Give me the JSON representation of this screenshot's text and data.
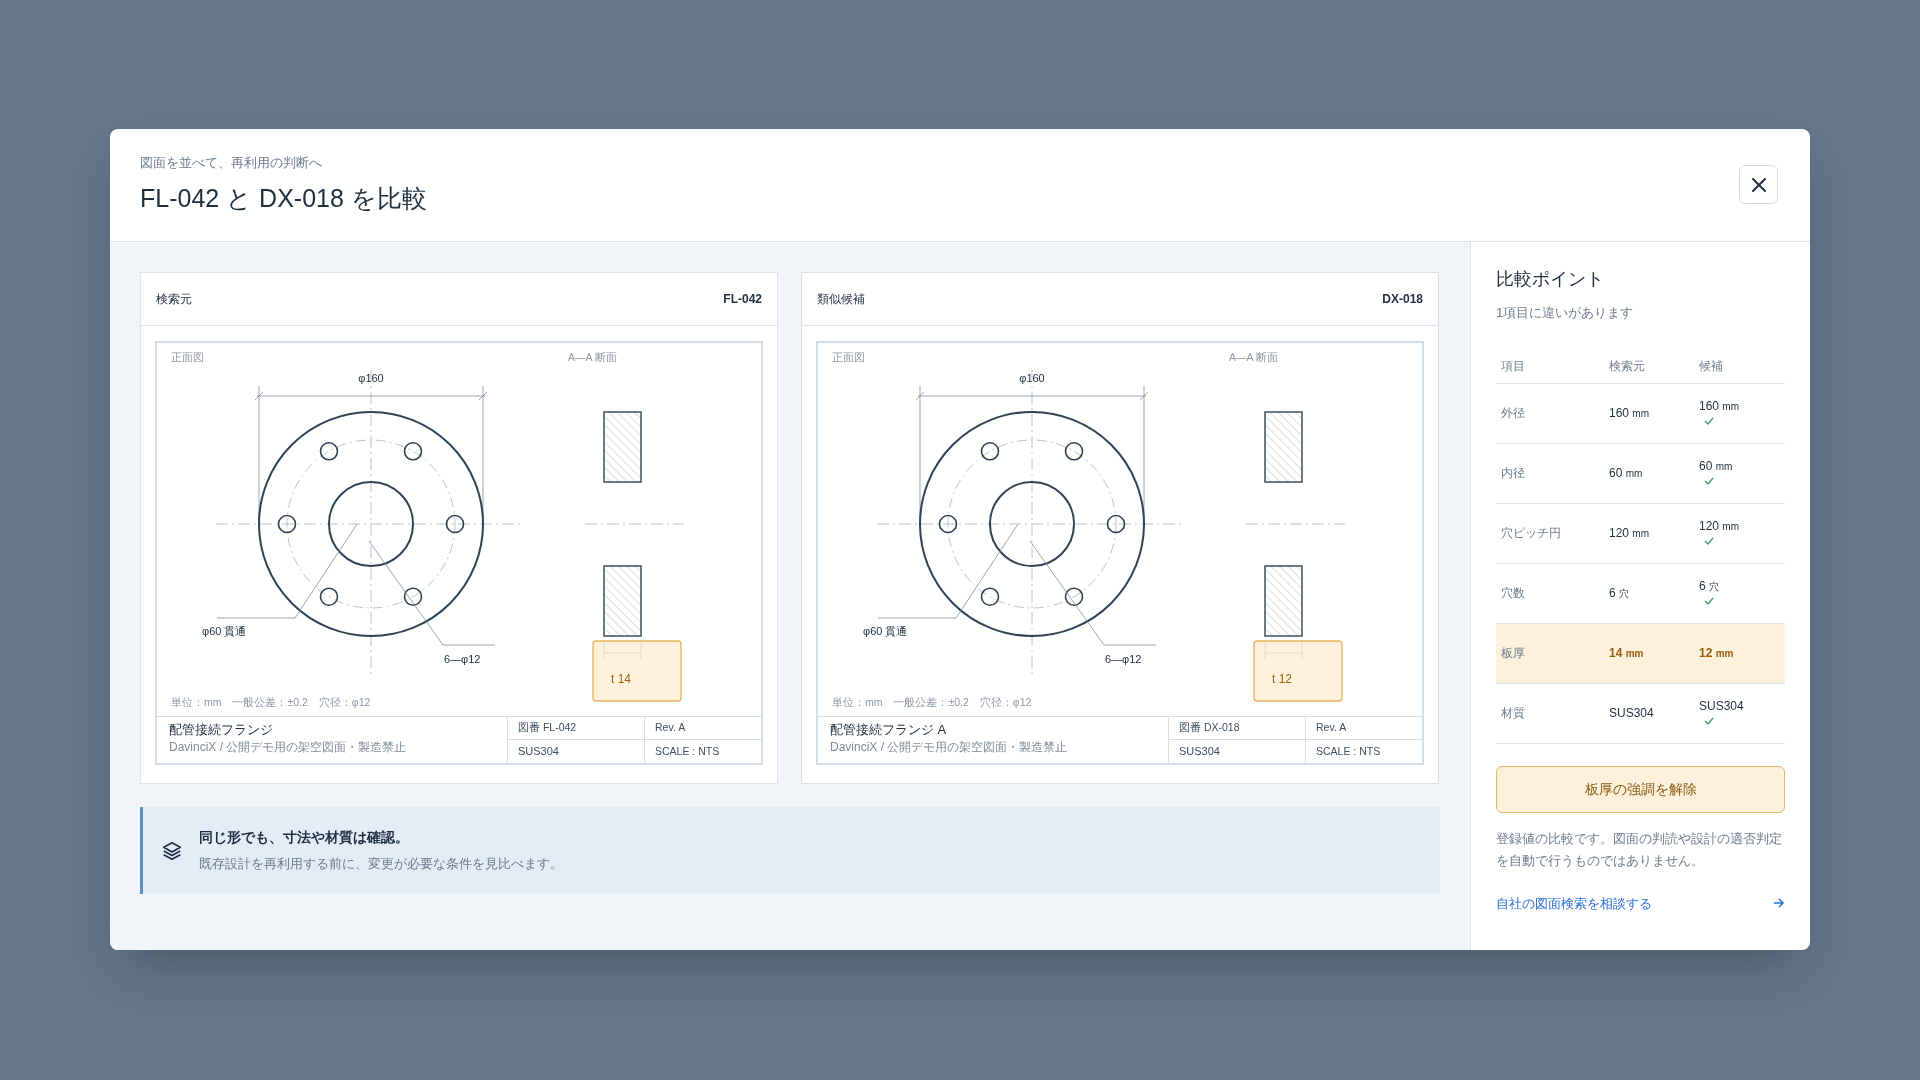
{
  "dialog": {
    "eyebrow": "図面を並べて、再利用の判断へ",
    "title": "FL-042 と DX-018 を比較"
  },
  "drawings": [
    {
      "role": "検索元",
      "code": "FL-042",
      "front_label": "正面図",
      "section_label": "A—A 断面",
      "outer_dim": "φ160",
      "bore_note": "φ60 貫通",
      "holes_note": "6—φ12",
      "thickness": "t 14",
      "thickness_highlighted": true,
      "notes": "単位：mm　一般公差：±0.2　穴径：φ12",
      "part_name": "配管接続フランジ",
      "disclaimer": "DavinciX / 公開デモ用の架空図面・製造禁止",
      "drawing_no": "図番 FL-042",
      "revision": "Rev. A",
      "material": "SUS304",
      "scale": "SCALE : NTS"
    },
    {
      "role": "類似候補",
      "code": "DX-018",
      "front_label": "正面図",
      "section_label": "A—A 断面",
      "outer_dim": "φ160",
      "bore_note": "φ60 貫通",
      "holes_note": "6—φ12",
      "thickness": "t 12",
      "thickness_highlighted": true,
      "notes": "単位：mm　一般公差：±0.2　穴径：φ12",
      "part_name": "配管接続フランジ A",
      "disclaimer": "DavinciX / 公開デモ用の架空図面・製造禁止",
      "drawing_no": "図番 DX-018",
      "revision": "Rev. A",
      "material": "SUS304",
      "scale": "SCALE : NTS"
    }
  ],
  "note": {
    "title": "同じ形でも、寸法や材質は確認。",
    "body": "既存設計を再利用する前に、変更が必要な条件を見比べます。"
  },
  "panel": {
    "title": "比較ポイント",
    "summary": "1項目に違いがあります",
    "columns": [
      "項目",
      "検索元",
      "候補"
    ],
    "rows": [
      {
        "label": "外径",
        "source": {
          "value": "160",
          "unit": "mm"
        },
        "candidate": {
          "value": "160",
          "unit": "mm"
        },
        "match": true,
        "highlighted": false
      },
      {
        "label": "内径",
        "source": {
          "value": "60",
          "unit": "mm"
        },
        "candidate": {
          "value": "60",
          "unit": "mm"
        },
        "match": true,
        "highlighted": false
      },
      {
        "label": "穴ピッチ円",
        "source": {
          "value": "120",
          "unit": "mm"
        },
        "candidate": {
          "value": "120",
          "unit": "mm"
        },
        "match": true,
        "highlighted": false
      },
      {
        "label": "穴数",
        "source": {
          "value": "6",
          "unit": "穴"
        },
        "candidate": {
          "value": "6",
          "unit": "穴"
        },
        "match": true,
        "highlighted": false
      },
      {
        "label": "板厚",
        "source": {
          "value": "14",
          "unit": "mm"
        },
        "candidate": {
          "value": "12",
          "unit": "mm"
        },
        "match": false,
        "highlighted": true
      },
      {
        "label": "材質",
        "source": {
          "value": "SUS304"
        },
        "candidate": {
          "value": "SUS304"
        },
        "match": true,
        "highlighted": false
      }
    ],
    "button": "板厚の強調を解除",
    "disclaimer": "登録値の比較です。図面の判読や設計の適否判定を自動で行うものではありません。",
    "link": "自社の図面検索を相談する"
  }
}
